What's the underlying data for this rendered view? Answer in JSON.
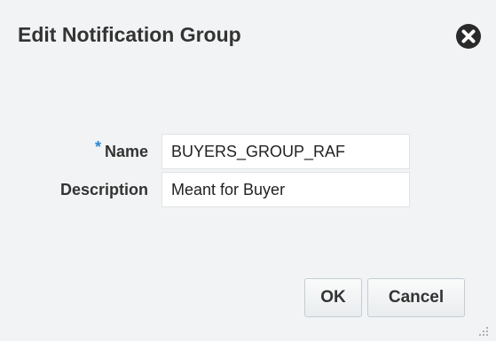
{
  "dialog": {
    "title": "Edit Notification Group"
  },
  "form": {
    "name": {
      "required_mark": "*",
      "label": "Name",
      "value": "BUYERS_GROUP_RAF"
    },
    "description": {
      "label": "Description",
      "value": "Meant for Buyer"
    }
  },
  "buttons": {
    "ok_label": "OK",
    "cancel_label": "Cancel"
  },
  "icons": {
    "close": "close-circle-x-icon",
    "resize": "resize-grip-icon"
  },
  "colors": {
    "dialog_background": "#f2f3f4",
    "required_mark": "#2b8ad6",
    "close_icon": "#2a2a2a"
  }
}
